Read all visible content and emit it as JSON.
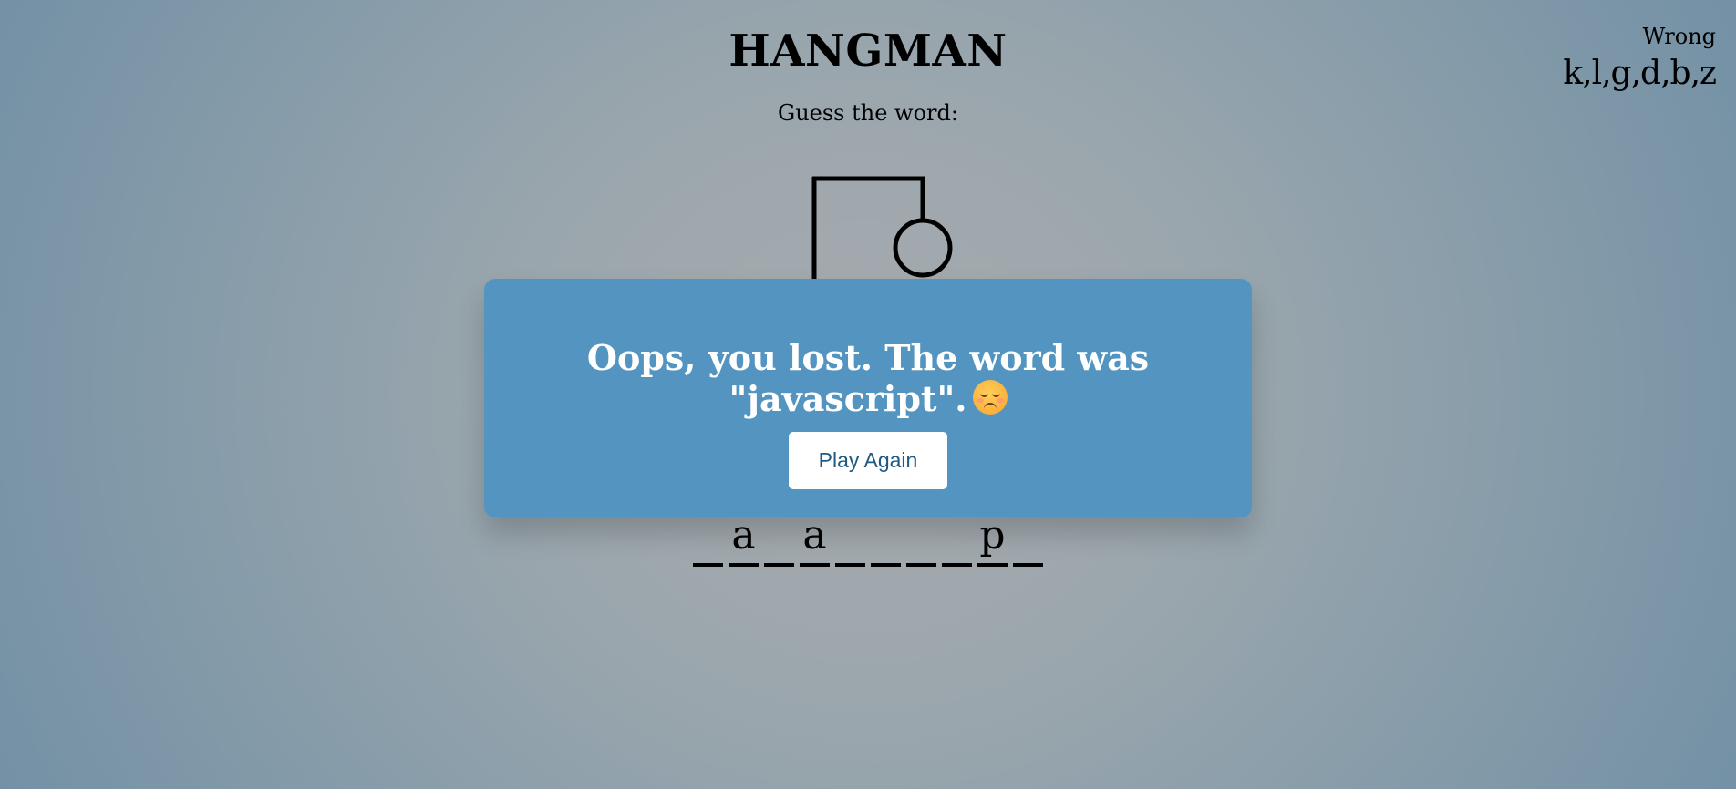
{
  "header": {
    "title": "HANGMAN",
    "subtitle": "Guess the word:"
  },
  "wrong": {
    "label": "Wrong",
    "letters": "k,l,g,d,b,z"
  },
  "word": {
    "letters": [
      "",
      "a",
      "",
      "a",
      "",
      "",
      "",
      "",
      "p",
      ""
    ]
  },
  "popup": {
    "message": "Oops, you lost. The word was \"javascript\".",
    "emoji": "pensive-face-icon",
    "button_label": "Play Again"
  },
  "colors": {
    "popup_background": "#5395c0",
    "button_text": "#1f5a82",
    "popup_text": "#ffffff"
  }
}
